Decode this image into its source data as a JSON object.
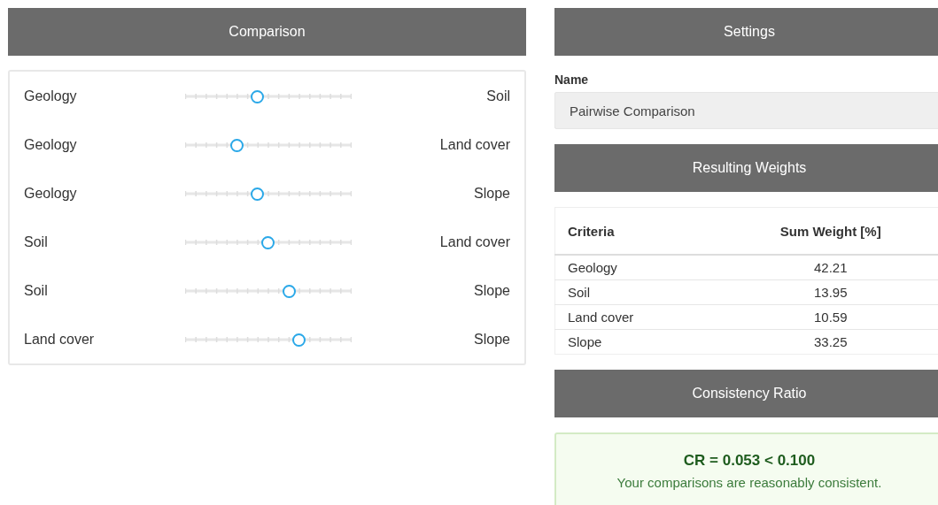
{
  "comparison": {
    "title": "Comparison",
    "pairs": [
      {
        "left": "Geology",
        "right": "Soil",
        "level": 0.4375
      },
      {
        "left": "Geology",
        "right": "Land cover",
        "level": 0.3125
      },
      {
        "left": "Geology",
        "right": "Slope",
        "level": 0.4375
      },
      {
        "left": "Soil",
        "right": "Land cover",
        "level": 0.5
      },
      {
        "left": "Soil",
        "right": "Slope",
        "level": 0.625
      },
      {
        "left": "Land cover",
        "right": "Slope",
        "level": 0.6875
      }
    ]
  },
  "settings": {
    "title": "Settings",
    "name_label": "Name",
    "name_value": "Pairwise Comparison"
  },
  "weights": {
    "title": "Resulting Weights",
    "columns": [
      "Criteria",
      "Sum Weight [%]"
    ],
    "rows": [
      [
        "Geology",
        "42.21"
      ],
      [
        "Soil",
        "13.95"
      ],
      [
        "Land cover",
        "10.59"
      ],
      [
        "Slope",
        "33.25"
      ]
    ]
  },
  "consistency": {
    "title": "Consistency Ratio",
    "ratio": "CR = 0.053 < 0.100",
    "message": "Your comparisons are reasonably consistent."
  }
}
